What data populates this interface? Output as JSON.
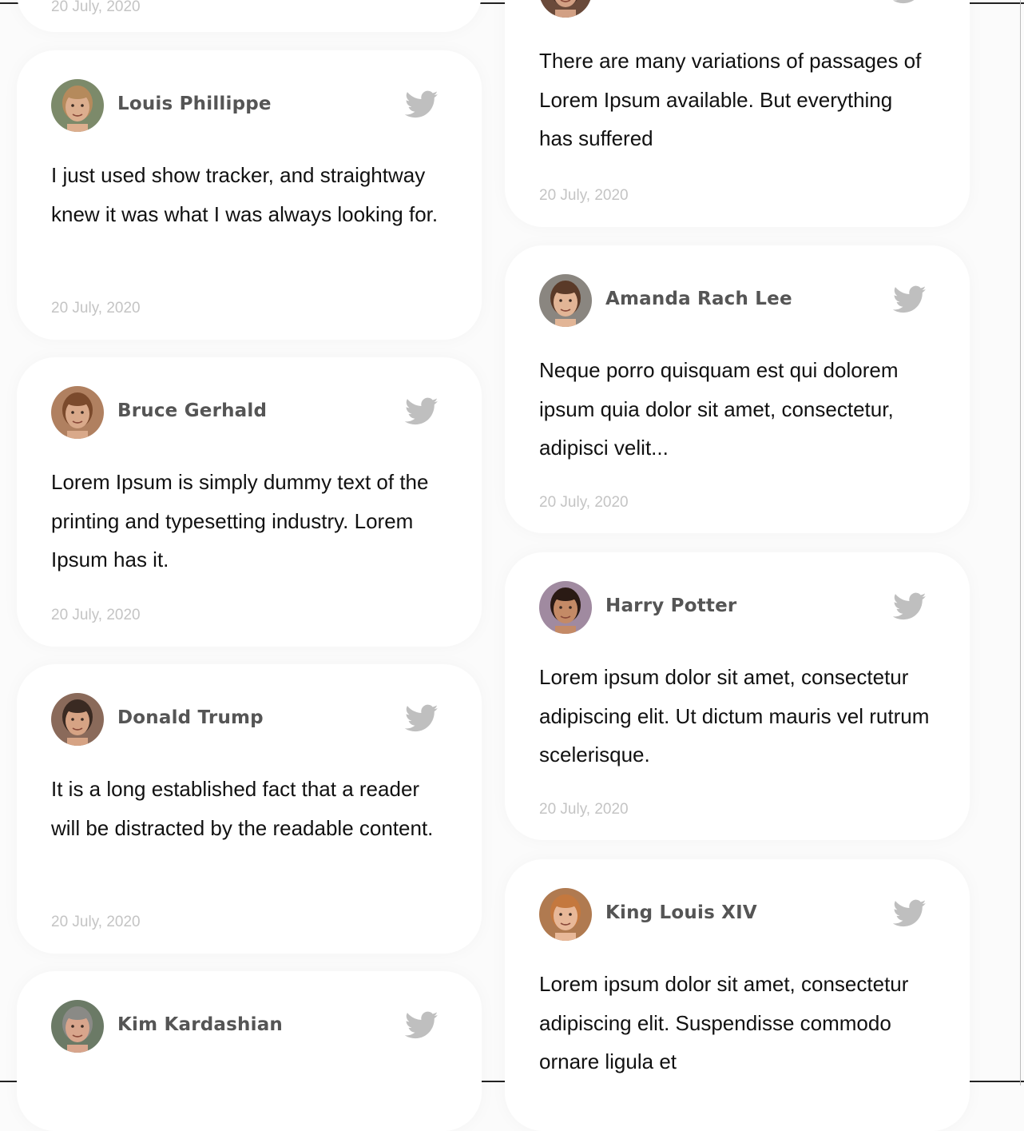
{
  "left_column": [
    {
      "date": "20 July, 2020"
    },
    {
      "name": "Louis Phillippe",
      "avatar": {
        "skin": "#dcae8e",
        "hair": "#b58a5c",
        "bg": "#7c8a6a"
      },
      "text": "I just used show tracker, and straightway knew it was what I was always looking for.",
      "date": "20 July, 2020"
    },
    {
      "name": "Bruce Gerhald",
      "avatar": {
        "skin": "#d9a98a",
        "hair": "#7b4a2c",
        "bg": "#b08060"
      },
      "text": "Lorem Ipsum is simply dummy text of the printing and typesetting industry. Lorem Ipsum has it.",
      "date": "20 July, 2020"
    },
    {
      "name": "Donald Trump",
      "avatar": {
        "skin": "#d6a384",
        "hair": "#3a2a22",
        "bg": "#8a6a5a"
      },
      "text": "It is a long established fact that a reader will be distracted by the readable content.",
      "date": "20 July, 2020"
    },
    {
      "name": "Kim Kardashian",
      "avatar": {
        "skin": "#d8a58c",
        "hair": "#8a8a86",
        "bg": "#6b7a66"
      }
    }
  ],
  "right_column": [
    {
      "text": "There are many variations of passages of Lorem Ipsum available. But everything has suffered",
      "date": "20 July, 2020",
      "avatar": {
        "skin": "#d2a084",
        "hair": "#4a3026",
        "bg": "#6a4a3a"
      }
    },
    {
      "name": "Amanda Rach Lee",
      "avatar": {
        "skin": "#e2b596",
        "hair": "#5a3a28",
        "bg": "#8a8680"
      },
      "text": "Neque porro quisquam est qui dolorem ipsum quia dolor sit amet, consectetur, adipisci velit...",
      "date": "20 July, 2020"
    },
    {
      "name": "Harry Potter",
      "avatar": {
        "skin": "#c48a66",
        "hair": "#2a1a14",
        "bg": "#a08aa0"
      },
      "text": "Lorem ipsum dolor sit amet, consectetur adipiscing elit. Ut dictum mauris vel rutrum scelerisque.",
      "date": "20 July, 2020"
    },
    {
      "name": "King Louis XIV",
      "avatar": {
        "skin": "#e8b898",
        "hair": "#c4783e",
        "bg": "#b07a50"
      },
      "text": "Lorem ipsum dolor sit amet, consectetur adipiscing elit. Suspendisse commodo ornare ligula et"
    }
  ],
  "colors": {
    "name": "#555555",
    "date": "#c4c4c4",
    "icon": "#bfbfbf",
    "text": "#111111"
  },
  "icons": {
    "social": "twitter-icon"
  }
}
